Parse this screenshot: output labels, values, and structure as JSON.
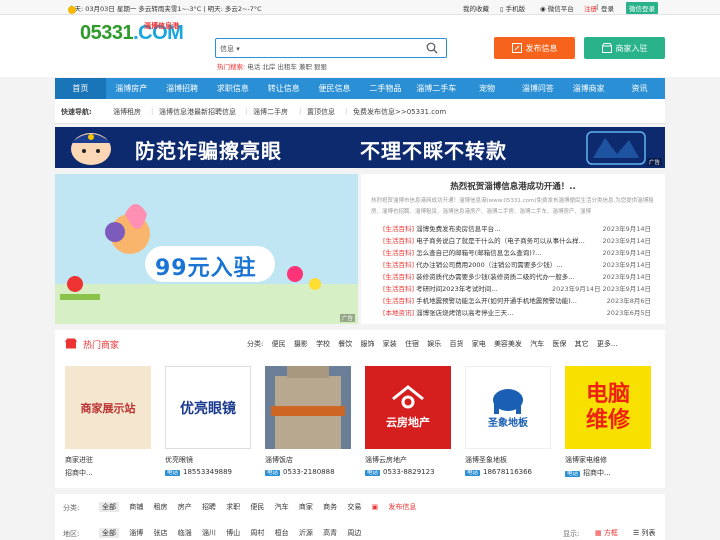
{
  "topbar": {
    "weather": "今天: 03月03日 星期一 多云转雨夹雪1~-3°C | 明天: 多云2~-7°C",
    "my_favorites": "我的收藏",
    "mobile": "手机版",
    "wechat": "微信平台",
    "register": "注册",
    "login_sep": "|",
    "login": "登录",
    "wechat_login": "微信登录"
  },
  "header": {
    "logo_num": "05331",
    "logo_com": ".COM",
    "logo_sub": "淄博信息港",
    "search_cat": "信息",
    "search_placeholder": "",
    "hot_label": "热门搜索:",
    "hot_terms": "电话 北岸 出租车 兼职 狠狠",
    "publish_btn": "发布信息",
    "join_btn": "商家入驻"
  },
  "nav": [
    "首页",
    "淄博房产",
    "淄博招聘",
    "求职信息",
    "转让信息",
    "便民信息",
    "二手物品",
    "淄博二手车",
    "宠物",
    "淄博问答",
    "淄博商家",
    "资讯"
  ],
  "quick": {
    "label": "快速导航:",
    "links": [
      "淄博租房",
      "淄博信息港最新招聘信息",
      "淄博二手房",
      "置顶信息",
      "免费发布信息>>05331.com"
    ]
  },
  "banner": {
    "text1": "防范诈骗擦亮眼",
    "text2": "不理不睬不转款",
    "badge": "广告"
  },
  "promo": {
    "text": "99元入驻",
    "badge": "广告"
  },
  "news": {
    "title": "热烈祝贺淄博信息港成功开通！..",
    "intro": "热烈祝贺淄博市信息港网成功开通！淄博信息港(www.05331.com)免费发布淄博便民生活分类信息,为您提供淄博租房、淄博也招聘、淄博租赁、淄博信息港房产、淄博二手房、淄博二手车、淄博房产、淄博",
    "rows": [
      {
        "tag": "[生活百科]",
        "text": "淄博免费发布卖房信息平台...",
        "date": "2023年9月14日"
      },
      {
        "tag": "[生活百科]",
        "text": "电子商务说白了就是干什么的（电子商务可以从事什么样...",
        "date": "2023年9月14日"
      },
      {
        "tag": "[生活百科]",
        "text": "怎么查自己的邮箱号(邮箱信息怎么查询)?...",
        "date": "2023年9月14日"
      },
      {
        "tag": "[生活百科]",
        "text": "代办注销公司费用2000（注销公司需要多少钱）...",
        "date": "2023年9月14日"
      },
      {
        "tag": "[生活百科]",
        "text": "装修资质代办需要多少钱(装修资质二级的代办一般多...",
        "date": "2023年9月14日"
      },
      {
        "tag": "[生活百科]",
        "text": "考研时间2023年考试时间...",
        "date": "2023年9月14日 2023年9月14日"
      },
      {
        "tag": "[生活百科]",
        "text": "手机地震预警功能怎么开(如何开通手机地震预警功能)...",
        "date": "2023年8月6日"
      },
      {
        "tag": "[本地资讯]",
        "text": "淄博张店烧烤馆以高考停业三天...",
        "date": "2023年6月5日"
      }
    ]
  },
  "merchants": {
    "title": "热门商家",
    "cat_label": "分类:",
    "categories": [
      "便民",
      "摄影",
      "学校",
      "餐饮",
      "服饰",
      "家装",
      "住宿",
      "娱乐",
      "百货",
      "家电",
      "美容美发",
      "汽车",
      "医保",
      "其它",
      "更多..."
    ],
    "items": [
      {
        "name": "商家进驻",
        "phone_tag": "",
        "phone": "招商中...",
        "img": "商家展示站"
      },
      {
        "name": "优亮眼镜",
        "phone_tag": "电话",
        "phone": "18553349889",
        "img": "优亮眼镜"
      },
      {
        "name": "淄博饭店",
        "phone_tag": "电话",
        "phone": "0533-2180888",
        "img": ""
      },
      {
        "name": "淄博云房地产",
        "phone_tag": "电话",
        "phone": "0533-8829123",
        "img": "云房地产"
      },
      {
        "name": "淄博圣象地板",
        "phone_tag": "电话",
        "phone": "18678116366",
        "img": "圣象地板"
      },
      {
        "name": "淄博家电维修",
        "phone_tag": "电话",
        "phone": "招商中...",
        "img": "电脑维修"
      }
    ]
  },
  "filter": {
    "cat_label": "分类:",
    "cats": [
      "全部",
      "商铺",
      "租房",
      "房产",
      "招聘",
      "求职",
      "便民",
      "汽车",
      "商家",
      "商务",
      "交易"
    ],
    "publish": "发布信息",
    "area_label": "地区:",
    "areas": [
      "全部",
      "淄博",
      "张店",
      "临淄",
      "淄川",
      "博山",
      "周村",
      "桓台",
      "沂源",
      "高青",
      "周边"
    ],
    "display_label": "显示:",
    "grid": "方框",
    "list": "列表"
  },
  "colors": {
    "brand_blue": "#2a8fd4",
    "orange": "#f5631c",
    "green": "#2ab28a",
    "red": "#e33"
  }
}
